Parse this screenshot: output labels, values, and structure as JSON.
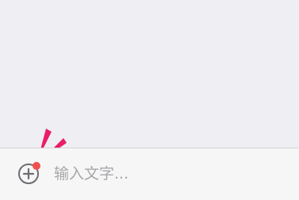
{
  "input_bar": {
    "placeholder": "输入文字..."
  },
  "icons": {
    "add": "plus-circle-icon",
    "badge": "red-dot-badge",
    "burst": "attention-burst-icon"
  },
  "colors": {
    "background": "#efeef3",
    "input_bar": "#f6f6f6",
    "badge": "#f0504d",
    "burst": "#e91e63",
    "icon": "#6d6d72",
    "placeholder": "#a7a7ab"
  }
}
